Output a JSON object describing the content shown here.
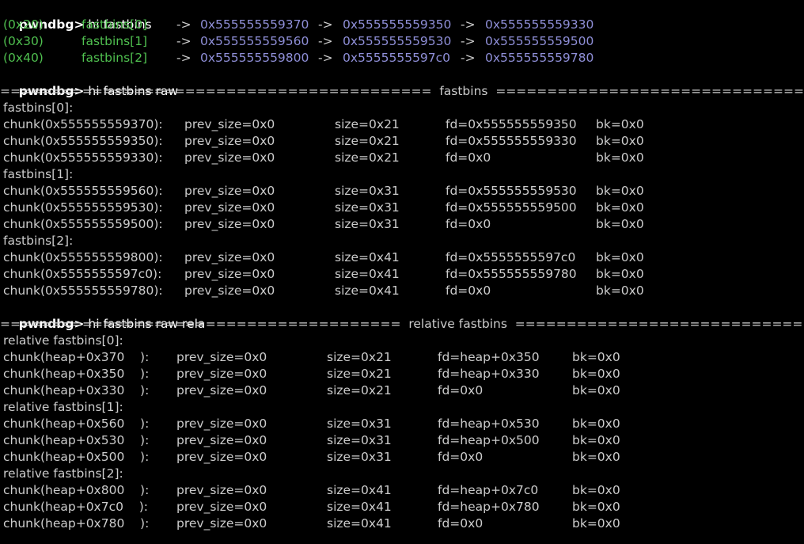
{
  "prompt": "pwndbg>",
  "commands": [
    "hi fastbins",
    "hi fastbins raw",
    "hi fastbins raw rela"
  ],
  "summary": [
    {
      "size": "(0x20)",
      "bin": "fastbins[0]",
      "arrow": "->",
      "addrs": [
        "0x555555559370",
        "0x555555559350",
        "0x555555559330"
      ]
    },
    {
      "size": "(0x30)",
      "bin": "fastbins[1]",
      "arrow": "->",
      "addrs": [
        "0x555555559560",
        "0x555555559530",
        "0x555555559500"
      ]
    },
    {
      "size": "(0x40)",
      "bin": "fastbins[2]",
      "arrow": "->",
      "addrs": [
        "0x555555559800",
        "0x5555555597c0",
        "0x555555559780"
      ]
    }
  ],
  "raw": {
    "header": "==========================================  fastbins  ============================================",
    "bins": [
      {
        "label": "fastbins[0]:",
        "chunks": [
          {
            "chunk": "chunk(0x555555559370):",
            "prev": "prev_size=0x0",
            "size": "size=0x21",
            "fd": "fd=0x555555559350",
            "bk": "bk=0x0"
          },
          {
            "chunk": "chunk(0x555555559350):",
            "prev": "prev_size=0x0",
            "size": "size=0x21",
            "fd": "fd=0x555555559330",
            "bk": "bk=0x0"
          },
          {
            "chunk": "chunk(0x555555559330):",
            "prev": "prev_size=0x0",
            "size": "size=0x21",
            "fd": "fd=0x0",
            "bk": "bk=0x0"
          }
        ]
      },
      {
        "label": "fastbins[1]:",
        "chunks": [
          {
            "chunk": "chunk(0x555555559560):",
            "prev": "prev_size=0x0",
            "size": "size=0x31",
            "fd": "fd=0x555555559530",
            "bk": "bk=0x0"
          },
          {
            "chunk": "chunk(0x555555559530):",
            "prev": "prev_size=0x0",
            "size": "size=0x31",
            "fd": "fd=0x555555559500",
            "bk": "bk=0x0"
          },
          {
            "chunk": "chunk(0x555555559500):",
            "prev": "prev_size=0x0",
            "size": "size=0x31",
            "fd": "fd=0x0",
            "bk": "bk=0x0"
          }
        ]
      },
      {
        "label": "fastbins[2]:",
        "chunks": [
          {
            "chunk": "chunk(0x555555559800):",
            "prev": "prev_size=0x0",
            "size": "size=0x41",
            "fd": "fd=0x5555555597c0",
            "bk": "bk=0x0"
          },
          {
            "chunk": "chunk(0x5555555597c0):",
            "prev": "prev_size=0x0",
            "size": "size=0x41",
            "fd": "fd=0x555555559780",
            "bk": "bk=0x0"
          },
          {
            "chunk": "chunk(0x555555559780):",
            "prev": "prev_size=0x0",
            "size": "size=0x41",
            "fd": "fd=0x0",
            "bk": "bk=0x0"
          }
        ]
      }
    ]
  },
  "rela": {
    "header": "=======================================  relative fastbins  ========================================",
    "bins": [
      {
        "label": "relative fastbins[0]:",
        "chunks": [
          {
            "chunk": "chunk(heap+0x370    ):",
            "prev": "prev_size=0x0",
            "size": "size=0x21",
            "fd": "fd=heap+0x350",
            "bk": "bk=0x0"
          },
          {
            "chunk": "chunk(heap+0x350    ):",
            "prev": "prev_size=0x0",
            "size": "size=0x21",
            "fd": "fd=heap+0x330",
            "bk": "bk=0x0"
          },
          {
            "chunk": "chunk(heap+0x330    ):",
            "prev": "prev_size=0x0",
            "size": "size=0x21",
            "fd": "fd=0x0",
            "bk": "bk=0x0"
          }
        ]
      },
      {
        "label": "relative fastbins[1]:",
        "chunks": [
          {
            "chunk": "chunk(heap+0x560    ):",
            "prev": "prev_size=0x0",
            "size": "size=0x31",
            "fd": "fd=heap+0x530",
            "bk": "bk=0x0"
          },
          {
            "chunk": "chunk(heap+0x530    ):",
            "prev": "prev_size=0x0",
            "size": "size=0x31",
            "fd": "fd=heap+0x500",
            "bk": "bk=0x0"
          },
          {
            "chunk": "chunk(heap+0x500    ):",
            "prev": "prev_size=0x0",
            "size": "size=0x31",
            "fd": "fd=0x0",
            "bk": "bk=0x0"
          }
        ]
      },
      {
        "label": "relative fastbins[2]:",
        "chunks": [
          {
            "chunk": "chunk(heap+0x800    ):",
            "prev": "prev_size=0x0",
            "size": "size=0x41",
            "fd": "fd=heap+0x7c0",
            "bk": "bk=0x0"
          },
          {
            "chunk": "chunk(heap+0x7c0    ):",
            "prev": "prev_size=0x0",
            "size": "size=0x41",
            "fd": "fd=heap+0x780",
            "bk": "bk=0x0"
          },
          {
            "chunk": "chunk(heap+0x780    ):",
            "prev": "prev_size=0x0",
            "size": "size=0x41",
            "fd": "fd=0x0",
            "bk": "bk=0x0"
          }
        ]
      }
    ]
  },
  "colors": {
    "background": "#000000",
    "text": "#cccccc",
    "green": "#4fbf4f",
    "address": "#8f8fd8",
    "prompt": "#ffffff"
  }
}
